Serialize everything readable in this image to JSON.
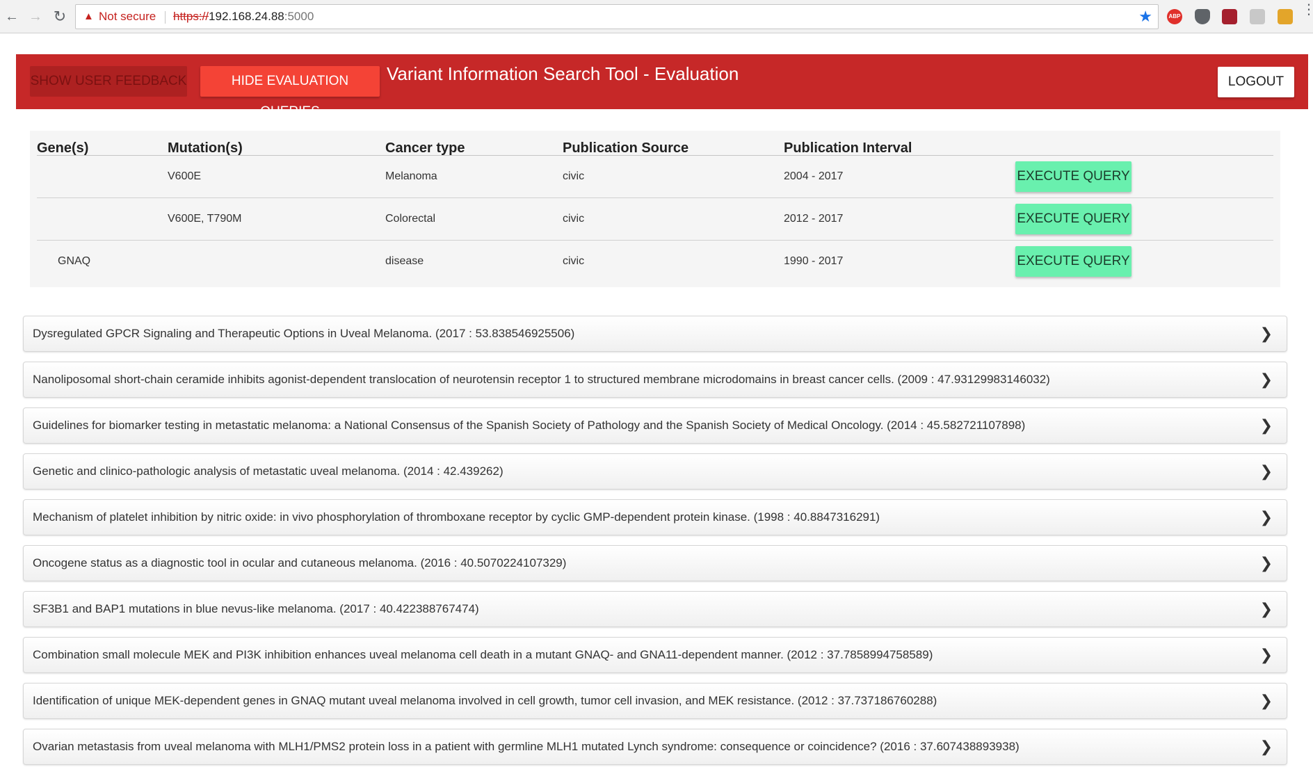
{
  "browser": {
    "security_label": "Not secure",
    "url_scheme": "https://",
    "url_host": "192.168.24.88",
    "url_port": ":5000",
    "extensions": [
      "ABP",
      "pocket",
      "mendeley",
      "reader",
      "extension"
    ]
  },
  "header": {
    "feedback_label": "SHOW USER FEEDBACK",
    "hide_label": "HIDE EVALUATION QUERIES",
    "title": "Variant Information Search Tool - Evaluation",
    "logout_label": "LOGOUT"
  },
  "queries": {
    "columns": [
      "Gene(s)",
      "Mutation(s)",
      "Cancer type",
      "Publication Source",
      "Publication Interval"
    ],
    "rows": [
      {
        "gene": "",
        "mutation": "V600E",
        "cancer": "Melanoma",
        "source": "civic",
        "interval": "2004 - 2017",
        "action": "EXECUTE QUERY"
      },
      {
        "gene": "",
        "mutation": "V600E, T790M",
        "cancer": "Colorectal",
        "source": "civic",
        "interval": "2012 - 2017",
        "action": "EXECUTE QUERY"
      },
      {
        "gene": "GNAQ",
        "mutation": "",
        "cancer": "disease",
        "source": "civic",
        "interval": "1990 - 2017",
        "action": "EXECUTE QUERY"
      }
    ]
  },
  "results": [
    "Dysregulated GPCR Signaling and Therapeutic Options in Uveal Melanoma. (2017 : 53.838546925506)",
    "Nanoliposomal short-chain ceramide inhibits agonist-dependent translocation of neurotensin receptor 1 to structured membrane microdomains in breast cancer cells. (2009 : 47.93129983146032)",
    "Guidelines for biomarker testing in metastatic melanoma: a National Consensus of the Spanish Society of Pathology and the Spanish Society of Medical Oncology. (2014 : 45.582721107898)",
    "Genetic and clinico-pathologic analysis of metastatic uveal melanoma. (2014 : 42.439262)",
    "Mechanism of platelet inhibition by nitric oxide: in vivo phosphorylation of thromboxane receptor by cyclic GMP-dependent protein kinase. (1998 : 40.8847316291)",
    "Oncogene status as a diagnostic tool in ocular and cutaneous melanoma. (2016 : 40.5070224107329)",
    "SF3B1 and BAP1 mutations in blue nevus-like melanoma. (2017 : 40.422388767474)",
    "Combination small molecule MEK and PI3K inhibition enhances uveal melanoma cell death in a mutant GNAQ- and GNA11-dependent manner. (2012 : 37.7858994758589)",
    "Identification of unique MEK-dependent genes in GNAQ mutant uveal melanoma involved in cell growth, tumor cell invasion, and MEK resistance. (2012 : 37.737186760288)",
    "Ovarian metastasis from uveal melanoma with MLH1/PMS2 protein loss in a patient with germline MLH1 mutated Lynch syndrome: consequence or coincidence? (2016 : 37.607438893938)"
  ],
  "colors": {
    "header_bg": "#c62828",
    "hide_button": "#f44336",
    "execute_button": "#69f0ae",
    "feedback_button": "#ad2121"
  }
}
